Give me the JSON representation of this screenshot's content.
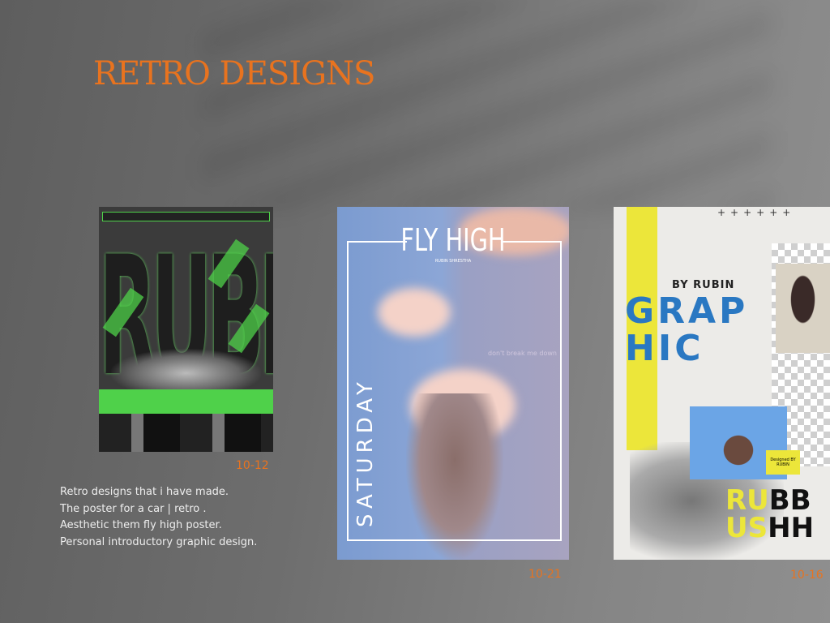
{
  "title": "RETRO DESIGNS",
  "description": [
    "Retro designs that i have made.",
    "The poster for a car | retro .",
    "Aesthetic them fly high poster.",
    "Personal introductory graphic design."
  ],
  "posters": [
    {
      "date": "10-12",
      "text": "RUBISH"
    },
    {
      "date": "10-21",
      "title": "FLY HIGH",
      "subtitle": "RUBIN SHRESTHA",
      "tagline": "don't break me down",
      "vertical": "SATURDAY"
    },
    {
      "date": "10-16",
      "by": "BY RUBIN",
      "word1": "GRAP",
      "word2": "HIC",
      "designed": "Designed BY RUBIN",
      "rub1": "RU",
      "rub1b": "BB",
      "rub2": "US",
      "rub2b": "HH"
    }
  ],
  "accent": "#e8731f"
}
